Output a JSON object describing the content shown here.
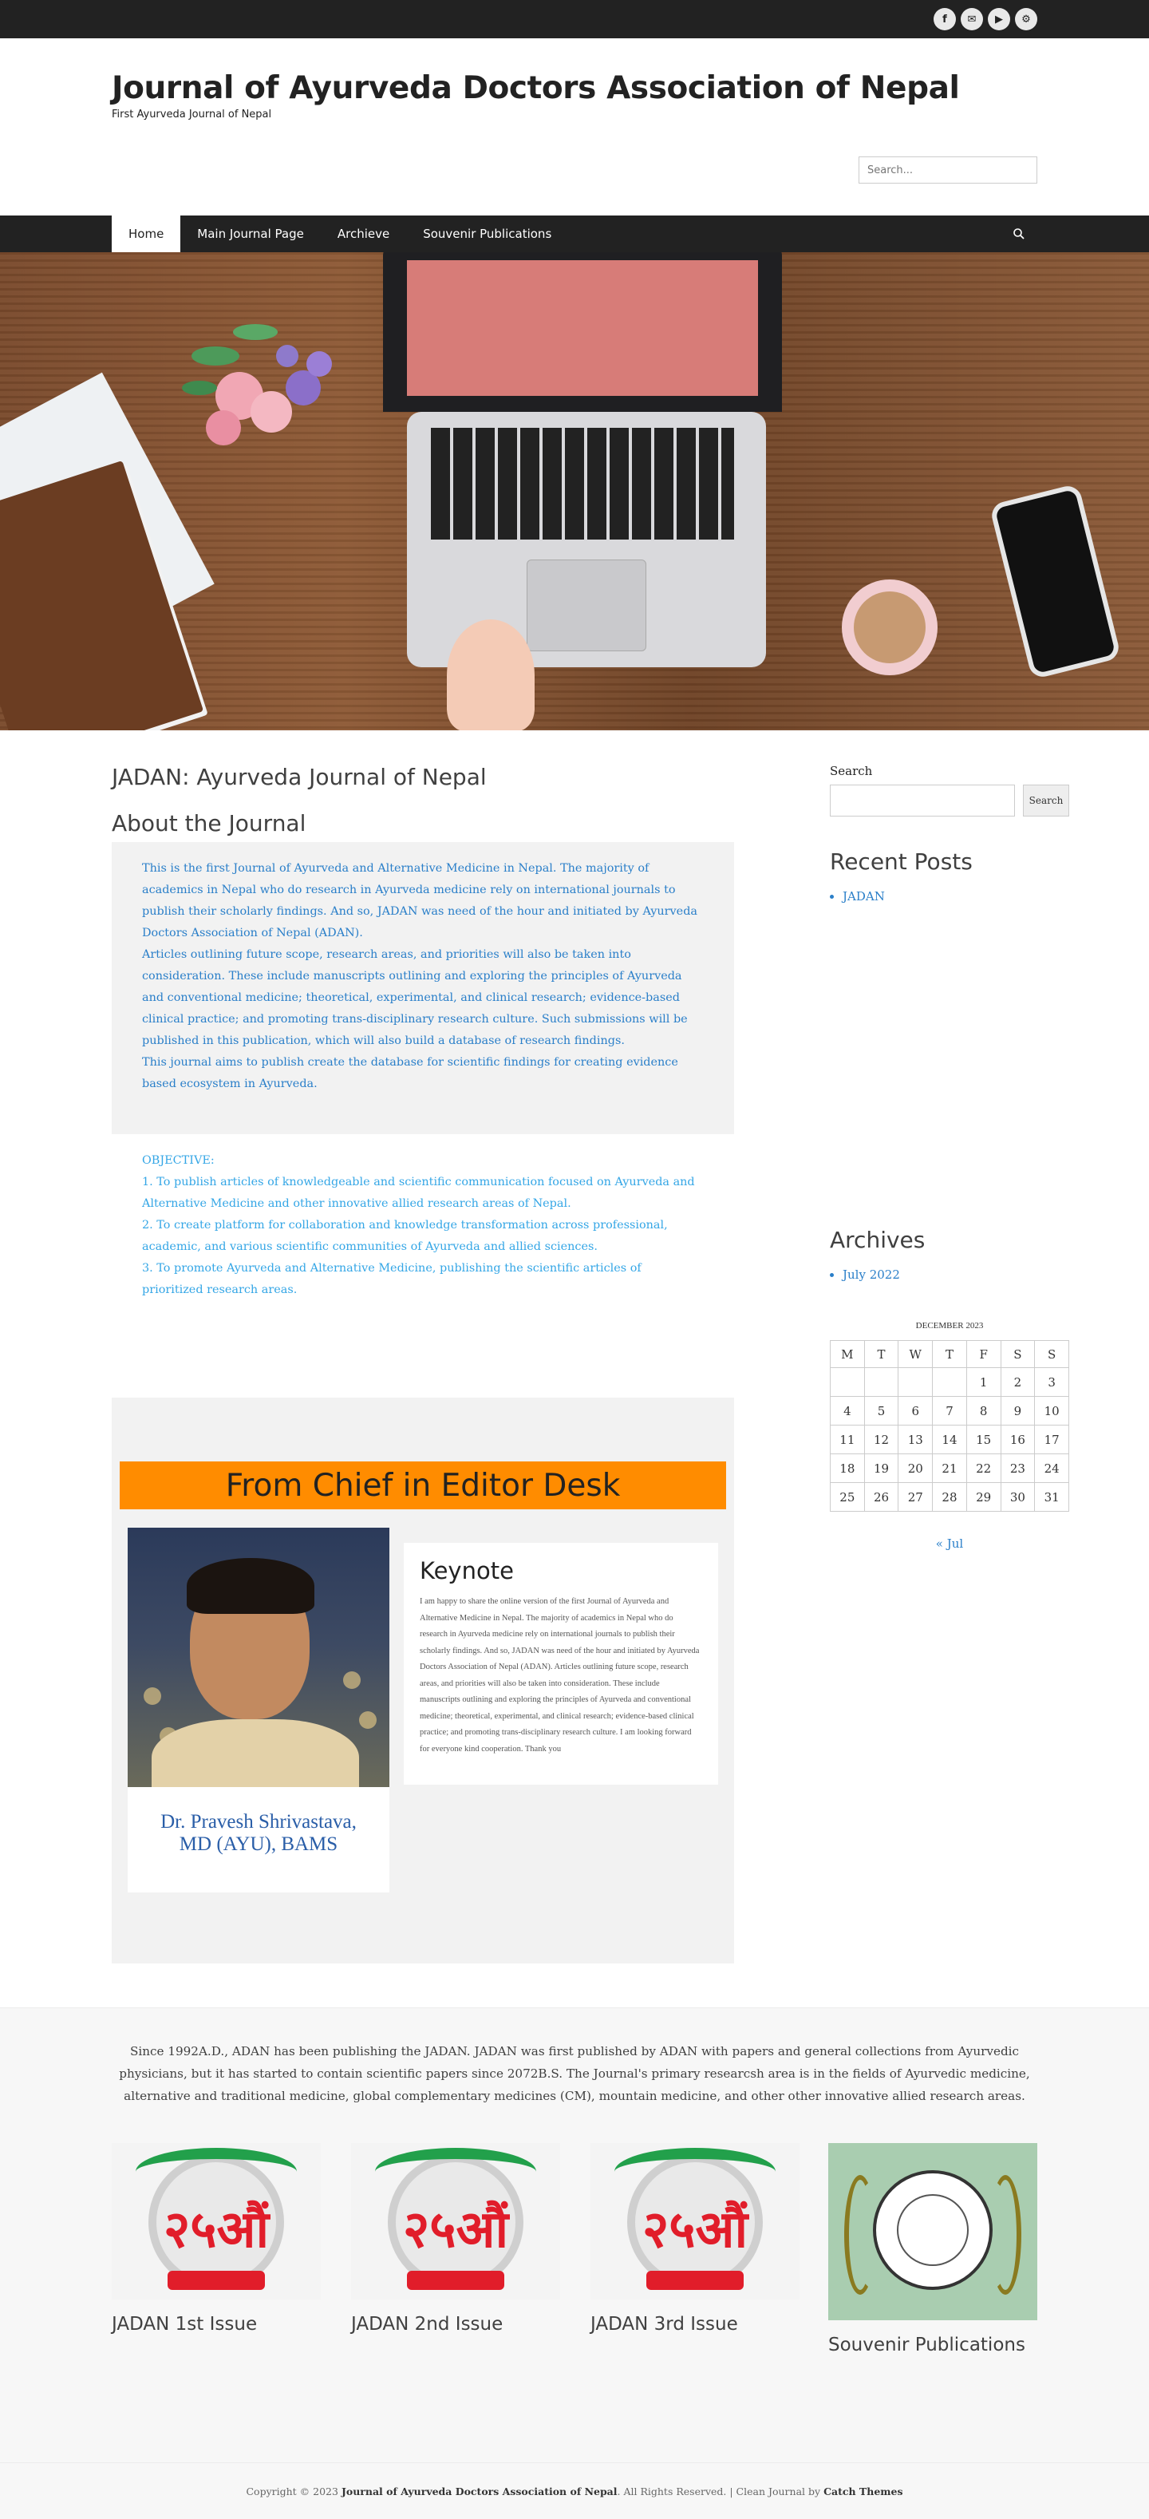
{
  "social": {
    "icons": [
      "facebook-icon",
      "email-icon",
      "youtube-icon",
      "share-icon"
    ],
    "glyphs": [
      "f",
      "✉",
      "▶",
      "⚙"
    ]
  },
  "header": {
    "title": "Journal of Ayurveda Doctors Association of Nepal",
    "tagline": "First Ayurveda Journal of Nepal",
    "search_placeholder": "Search..."
  },
  "nav": {
    "items": [
      "Home",
      "Main Journal Page",
      "Archieve",
      "Souvenir Publications"
    ],
    "active_index": 0
  },
  "main": {
    "page_title": "JADAN: Ayurveda Journal of Nepal",
    "about_title": "About the Journal",
    "intro_paragraphs": [
      "This is the first Journal of Ayurveda and Alternative Medicine in Nepal. The majority of academics in Nepal who do research in Ayurveda medicine rely on international journals to publish their scholarly findings. And so, JADAN was need of the hour and initiated by Ayurveda Doctors Association of Nepal (ADAN).",
      "Articles outlining future scope, research areas, and priorities will also be taken into consideration. These include manuscripts outlining and exploring the principles of Ayurveda and conventional medicine; theoretical, experimental, and clinical research; evidence-based clinical practice; and promoting trans-disciplinary research culture. Such submissions will be published in this publication, which will also build a database of research findings.",
      "This journal aims to publish create the database for scientific findings for creating evidence based ecosystem in Ayurveda."
    ],
    "objective_heading": "OBJECTIVE:",
    "objectives": [
      "1. To publish articles of knowledgeable and scientific communication focused on Ayurveda and Alternative Medicine and other innovative allied research areas of Nepal.",
      "2. To create platform for collaboration and knowledge transformation across professional, academic, and various scientific communities of Ayurveda and allied sciences.",
      "3. To promote Ayurveda and Alternative Medicine, publishing the scientific articles of prioritized research areas."
    ],
    "chief": {
      "banner": "From Chief in Editor Desk",
      "name_line1": "Dr. Pravesh Shrivastava,",
      "name_line2": "MD (AYU), BAMS",
      "keynote_title": "Keynote",
      "keynote_text": "I am happy to share the online version of  the first Journal of Ayurveda and Alternative Medicine in Nepal. The majority of academics in Nepal who do research in Ayurveda medicine rely on international journals to publish their scholarly findings. And so, JADAN was need of the hour and initiated by Ayurveda Doctors Association of Nepal (ADAN). Articles outlining future scope, research areas, and priorities will also be taken into consideration. These include manuscripts outlining and exploring the principles of Ayurveda and conventional medicine; theoretical, experimental, and clinical research; evidence-based clinical practice; and promoting trans-disciplinary research culture. I am looking forward for everyone kind cooperation. Thank you"
    }
  },
  "sidebar": {
    "search_title": "Search",
    "search_button": "Search",
    "recent_title": "Recent Posts",
    "recent_posts": [
      "JADAN"
    ],
    "archives_title": "Archives",
    "archives": [
      "July 2022"
    ],
    "calendar": {
      "caption": "DECEMBER 2023",
      "weekdays": [
        "M",
        "T",
        "W",
        "T",
        "F",
        "S",
        "S"
      ],
      "weeks": [
        [
          "",
          "",
          "",
          "",
          "1",
          "2",
          "3"
        ],
        [
          "4",
          "5",
          "6",
          "7",
          "8",
          "9",
          "10"
        ],
        [
          "11",
          "12",
          "13",
          "14",
          "15",
          "16",
          "17"
        ],
        [
          "18",
          "19",
          "20",
          "21",
          "22",
          "23",
          "24"
        ],
        [
          "25",
          "26",
          "27",
          "28",
          "29",
          "30",
          "31"
        ]
      ],
      "prev_link": "« Jul"
    }
  },
  "footer": {
    "about_text": "Since 1992A.D., ADAN has been publishing the JADAN. JADAN was first published by ADAN with papers and general collections from Ayurvedic physicians, but it has started to contain scientific papers since 2072B.S. The Journal's primary researcsh area is in the fields of Ayurvedic medicine, alternative and traditional medicine, global complementary medicines (CM), mountain medicine, and other other innovative allied research areas.",
    "issues": [
      "JADAN 1st Issue",
      "JADAN 2nd Issue",
      "JADAN 3rd Issue",
      "Souvenir Publications"
    ],
    "badge_number": "२५औं",
    "copyright_prefix": "Copyright © 2023",
    "copyright_site": "Journal of Ayurveda Doctors Association of Nepal",
    "copyright_mid": ". All Rights Reserved. | Clean Journal by",
    "copyright_theme": "Catch Themes"
  },
  "colors": {
    "link": "#2a7fc9",
    "objective": "#34a6e6",
    "banner": "#ff8c00",
    "dark_bar": "#222222"
  }
}
